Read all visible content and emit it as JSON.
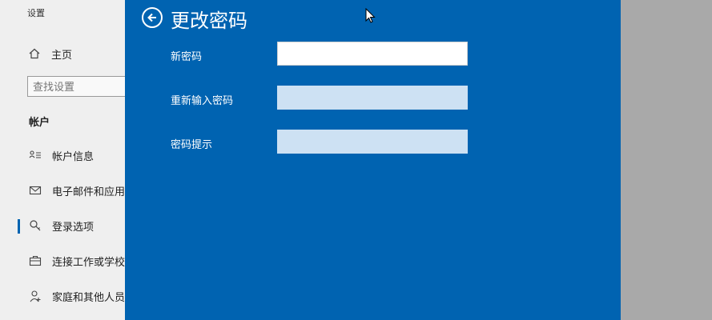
{
  "settings": {
    "app_title": "设置",
    "home_label": "主页",
    "search_placeholder": "查找设置",
    "section_title": "帐户",
    "nav_items": [
      {
        "label": "帐户信息",
        "icon": "account-info-icon"
      },
      {
        "label": "电子邮件和应用",
        "icon": "mail-icon"
      },
      {
        "label": "登录选项",
        "icon": "key-icon",
        "active": true
      },
      {
        "label": "连接工作或学校",
        "icon": "briefcase-icon"
      },
      {
        "label": "家庭和其他人员",
        "icon": "person-icon"
      }
    ]
  },
  "dialog": {
    "title": "更改密码",
    "fields": [
      {
        "label": "新密码",
        "value": "",
        "state": "enabled"
      },
      {
        "label": "重新输入密码",
        "value": "",
        "state": "disabled"
      },
      {
        "label": "密码提示",
        "value": "",
        "state": "disabled"
      }
    ]
  },
  "colors": {
    "dialog_bg": "#0063b1",
    "disabled_field": "#cde1f3",
    "accent": "#0063b1"
  }
}
